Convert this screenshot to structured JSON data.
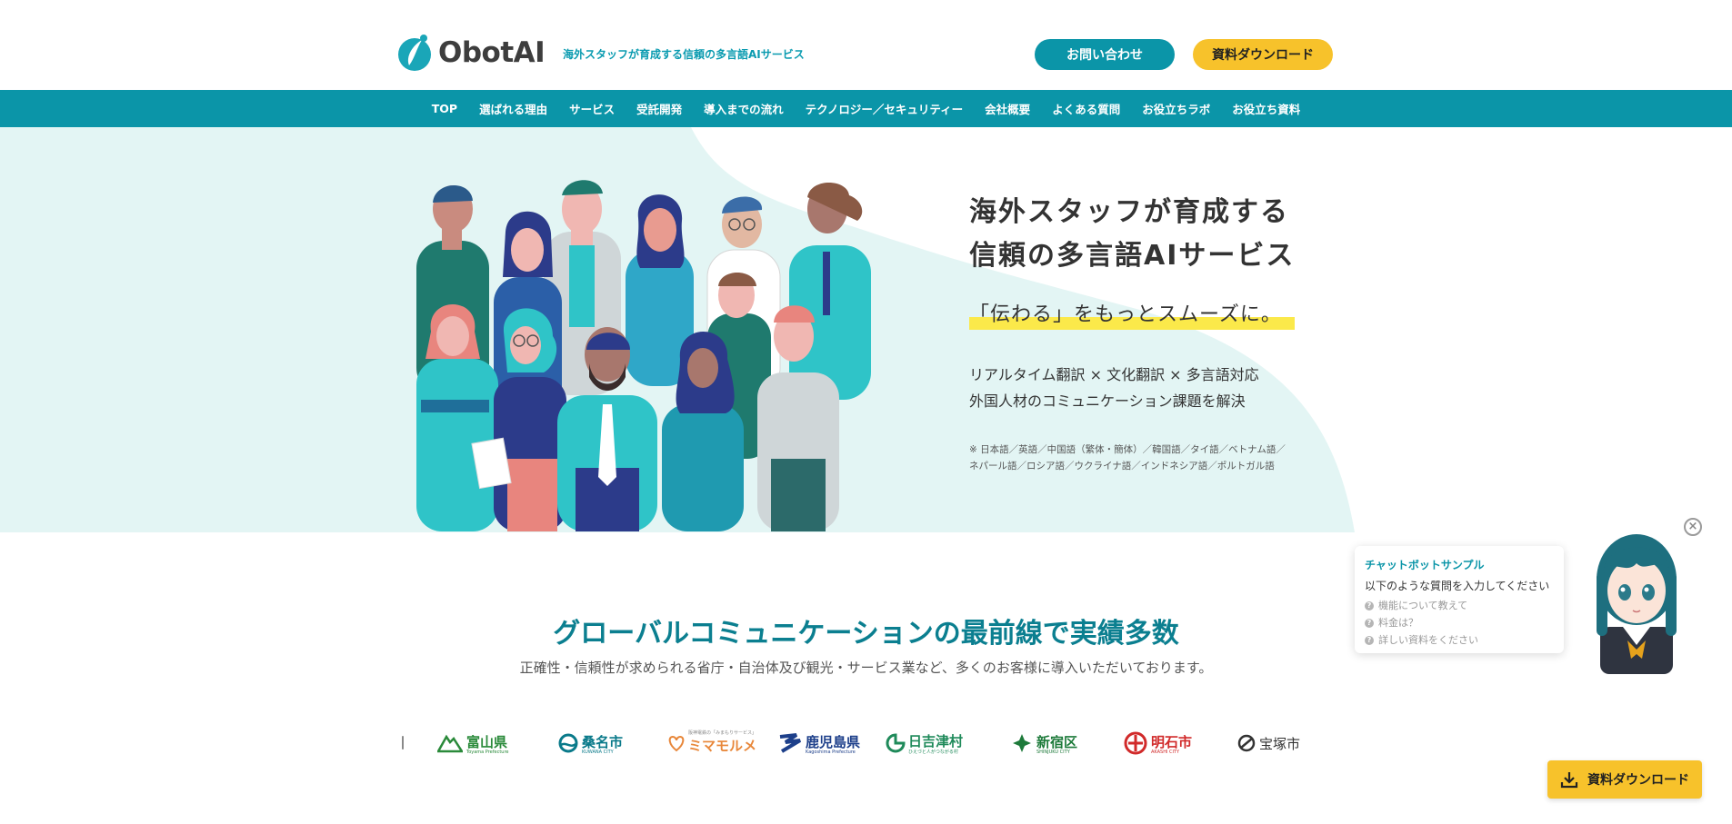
{
  "header": {
    "logo_text": "ObotAI",
    "tagline": "海外スタッフが育成する信頼の多言語AIサービス",
    "contact_label": "お問い合わせ",
    "download_label": "資料ダウンロード"
  },
  "nav": {
    "items": [
      {
        "label": "TOP"
      },
      {
        "label": "選ばれる理由"
      },
      {
        "label": "サービス"
      },
      {
        "label": "受託開発"
      },
      {
        "label": "導入までの流れ"
      },
      {
        "label": "テクノロジー／セキュリティー"
      },
      {
        "label": "会社概要"
      },
      {
        "label": "よくある質問"
      },
      {
        "label": "お役立ちラボ"
      },
      {
        "label": "お役立ち資料"
      }
    ]
  },
  "hero": {
    "title_line1": "海外スタッフが育成する",
    "title_line2": "信頼の多言語AIサービス",
    "catch": "「伝わる」をもっとスムーズに。",
    "desc_line1": "リアルタイム翻訳 × 文化翻訳 × 多言語対応",
    "desc_line2": "外国人材のコミュニケーション課題を解決",
    "note": "※ 日本語／英語／中国語（繁体・簡体）／韓国語／タイ語／ベトナム語／ネパール語／ロシア語／ウクライナ語／インドネシア語／ポルトガル語"
  },
  "section": {
    "title": "グローバルコミュニケーションの最前線で実績多数",
    "subtitle": "正確性・信頼性が求められる省庁・自治体及び観光・サービス業など、多くのお客様に導入いただいております。"
  },
  "client_logos": [
    {
      "name": "富山県",
      "sub": "Toyama Prefecture",
      "color": "#2a8a3a"
    },
    {
      "name": "桑名市",
      "sub": "KUWANA CITY",
      "color": "#0a7a8a"
    },
    {
      "name": "ミマモルメ",
      "sub": "阪神電鉄の「みまもりサービス」",
      "color": "#e8873a"
    },
    {
      "name": "鹿児島県",
      "sub": "Kagoshima Prefecture",
      "color": "#1d3f8a"
    },
    {
      "name": "日吉津村",
      "sub": "ひえづと人がつながる村",
      "color": "#1f8a5a"
    },
    {
      "name": "新宿区",
      "sub": "SHINJUKU CITY",
      "color": "#1d7a3a"
    },
    {
      "name": "明石市",
      "sub": "AKASHI CITY",
      "color": "#d12a2a"
    },
    {
      "name": "宝塚市",
      "sub": "",
      "color": "#333333"
    }
  ],
  "chatbot": {
    "title": "チャットボットサンプル",
    "lead": "以下のような質問を入力してください",
    "questions": [
      "機能について教えて",
      "料金は？",
      "詳しい資料をください"
    ],
    "close_label": "×"
  },
  "float_button": {
    "label": "資料ダウンロード"
  },
  "colors": {
    "brand": "#0b95a8",
    "accent": "#f7c22b",
    "hero_bg": "#e3f5f4",
    "highlight": "#fbe94a"
  }
}
